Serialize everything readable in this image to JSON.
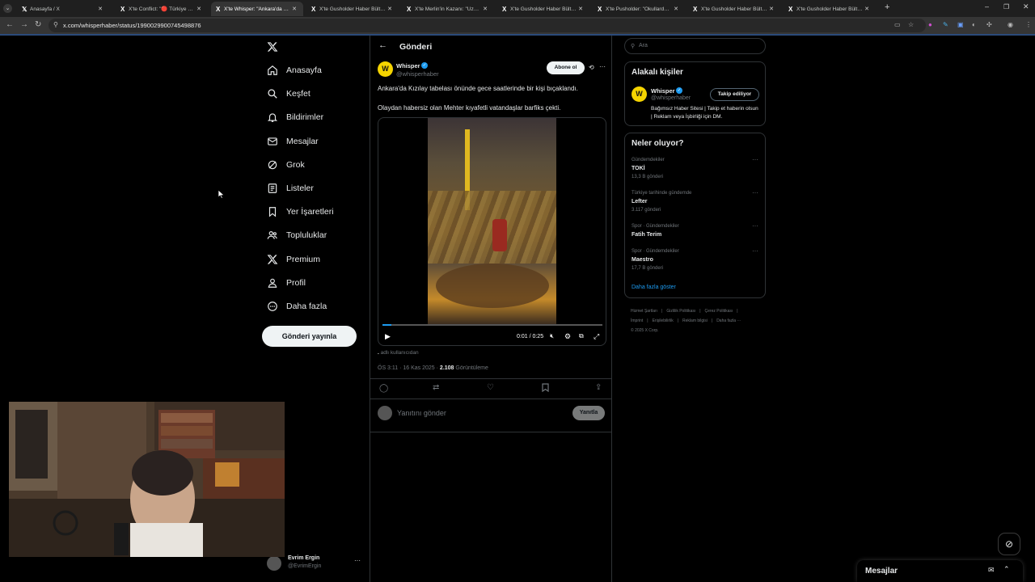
{
  "browser": {
    "tabs": [
      {
        "title": "Anasayfa / X"
      },
      {
        "title": "X'te Conflict: \"🔴 Türkiye genel..."
      },
      {
        "title": "X'te Whisper: \"Ankara'da Kızılay..."
      },
      {
        "title": "X'te Gusholder Haber Bülteni: \"..."
      },
      {
        "title": "X'te Merlin'in Kazanı: \"Uzun süre..."
      },
      {
        "title": "X'te Gusholder Haber Bülteni: \"..."
      },
      {
        "title": "X'te Pusholder: \"Okullarda ara t..."
      },
      {
        "title": "X'te Gusholder Haber Bülteni: \"..."
      },
      {
        "title": "X'te Gusholder Haber Bülteni: \"..."
      }
    ],
    "url": "x.com/whisperhaber/status/1990029900745498876"
  },
  "nav": {
    "items": [
      {
        "label": "Anasayfa",
        "icon": "home-icon"
      },
      {
        "label": "Keşfet",
        "icon": "search-icon"
      },
      {
        "label": "Bildirimler",
        "icon": "bell-icon"
      },
      {
        "label": "Mesajlar",
        "icon": "mail-icon"
      },
      {
        "label": "Grok",
        "icon": "grok-icon"
      },
      {
        "label": "Listeler",
        "icon": "list-icon"
      },
      {
        "label": "Yer İşaretleri",
        "icon": "bookmark-icon"
      },
      {
        "label": "Topluluklar",
        "icon": "communities-icon"
      },
      {
        "label": "Premium",
        "icon": "x-logo-icon"
      },
      {
        "label": "Profil",
        "icon": "profile-icon"
      },
      {
        "label": "Daha fazla",
        "icon": "more-icon"
      }
    ],
    "post_button": "Gönderi yayınla",
    "account": {
      "name": "Evrim Ergin",
      "handle": "@EvrimErgin"
    }
  },
  "post": {
    "header_title": "Gönderi",
    "author_name": "Whisper",
    "author_handle": "@whisperhaber",
    "subscribe_label": "Abone ol",
    "text1": "Ankara'da Kızılay tabelası önünde gece saatlerinde bir kişi bıçaklandı.",
    "text2": "Olaydan habersiz olan Mehter kıyafetli vatandaşlar barfiks çekti.",
    "video_time": "0:01 / 0:25",
    "video_progress": 0.04,
    "media_source": "adlı kullanıcıdan",
    "time": "ÖS 3:11 · 16 Kas 2025 · ",
    "views": "2.108",
    "views_label": " Görüntüleme",
    "reply_placeholder": "Yanıtını gönder",
    "reply_button": "Yanıtla"
  },
  "right": {
    "search_placeholder": "Ara",
    "related_title": "Alakalı kişiler",
    "related": {
      "name": "Whisper",
      "handle": "@whisperhaber",
      "follow_label": "Takip ediliyor",
      "bio": "Bağımsız Haber Sitesi | Takip et haberin olsun | Reklam veya İşbirliği için DM."
    },
    "trends_title": "Neler oluyor?",
    "trends": [
      {
        "context": "Gündemdekiler",
        "name": "TOKİ",
        "count": "13,3 B gönderi"
      },
      {
        "context": "Türkiye tarihinde gündemde",
        "name": "Lefter",
        "count": "3.117 gönderi"
      },
      {
        "context": "Spor · Gündemdekiler",
        "name": "Fatih Terim",
        "count": ""
      },
      {
        "context": "Spor · Gündemdekiler",
        "name": "Maestro",
        "count": "17,7 B gönderi"
      }
    ],
    "show_more": "Daha fazla göster",
    "footer": [
      "Hizmet Şartları",
      "|",
      "Gizlilik Politikası",
      "|",
      "Çerez Politikası",
      "|",
      "İmprint",
      "|",
      "Erişilebilirlik",
      "|",
      "Reklam bilgisi",
      "|",
      "Daha fazla ···"
    ],
    "copyright": "© 2025 X Corp."
  },
  "messages_bar": {
    "title": "Mesajlar"
  },
  "colors": {
    "accent": "#1d9bf0",
    "background": "#000000",
    "border": "#2f3336",
    "muted": "#71767b"
  }
}
